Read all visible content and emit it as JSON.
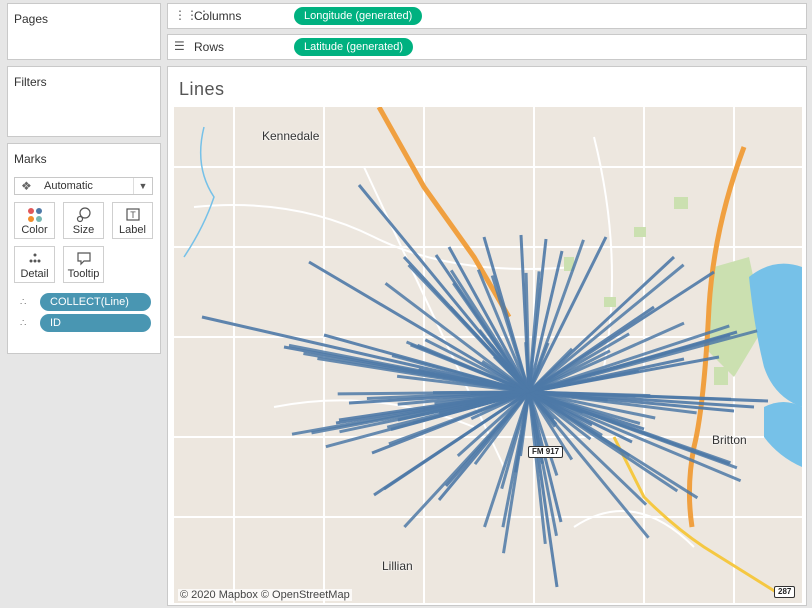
{
  "sidebar": {
    "pages_title": "Pages",
    "filters_title": "Filters",
    "marks_title": "Marks",
    "mark_type": "Automatic",
    "buttons": [
      {
        "label": "Color",
        "icon": "color-icon"
      },
      {
        "label": "Size",
        "icon": "size-icon"
      },
      {
        "label": "Label",
        "icon": "label-icon"
      },
      {
        "label": "Detail",
        "icon": "detail-icon"
      },
      {
        "label": "Tooltip",
        "icon": "tooltip-icon"
      }
    ],
    "pills": [
      "COLLECT(Line)",
      "ID"
    ]
  },
  "shelves": {
    "columns_label": "Columns",
    "columns_pill": "Longitude (generated)",
    "rows_label": "Rows",
    "rows_pill": "Latitude (generated)"
  },
  "viz": {
    "title": "Lines",
    "places": [
      "Kennedale",
      "Britton",
      "Lillian"
    ],
    "road_shields": [
      "FM 917",
      "287"
    ],
    "attribution": "© 2020 Mapbox © OpenStreetMap",
    "line_color": "#4e79a7",
    "highway_color": "#f0a040",
    "water_color": "#76c1e8",
    "park_color": "#cbe0b0"
  }
}
